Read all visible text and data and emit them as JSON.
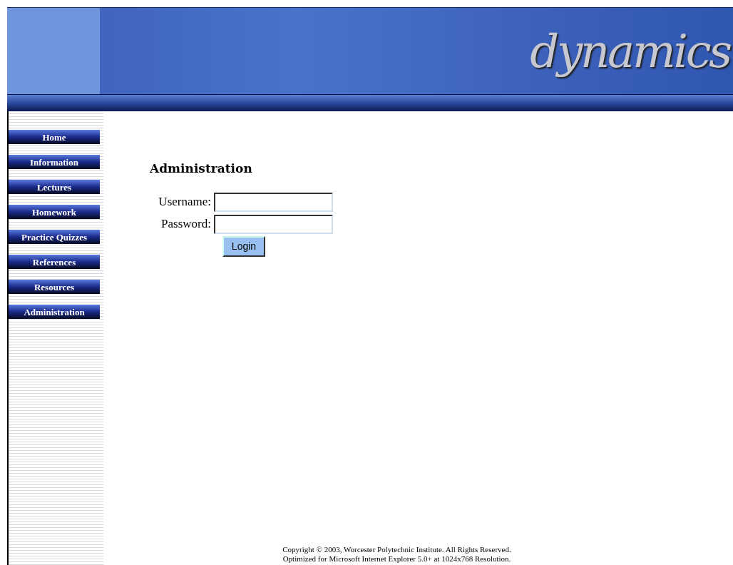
{
  "header": {
    "logo": "dynamics"
  },
  "nav": [
    {
      "label": "Home"
    },
    {
      "label": "Information"
    },
    {
      "label": "Lectures"
    },
    {
      "label": "Homework"
    },
    {
      "label": "Practice Quizzes"
    },
    {
      "label": "References"
    },
    {
      "label": "Resources"
    },
    {
      "label": "Administration"
    }
  ],
  "main": {
    "title": "Administration",
    "fields": [
      {
        "label": "Username:"
      },
      {
        "label": "Password:"
      }
    ],
    "button": "Login"
  },
  "footer": [
    "Copyright © 2003, Worcester Polytechnic Institute. All Rights Reserved.",
    "Optimized for Microsoft Internet Explorer 5.0+ at 1024x768 Resolution."
  ]
}
